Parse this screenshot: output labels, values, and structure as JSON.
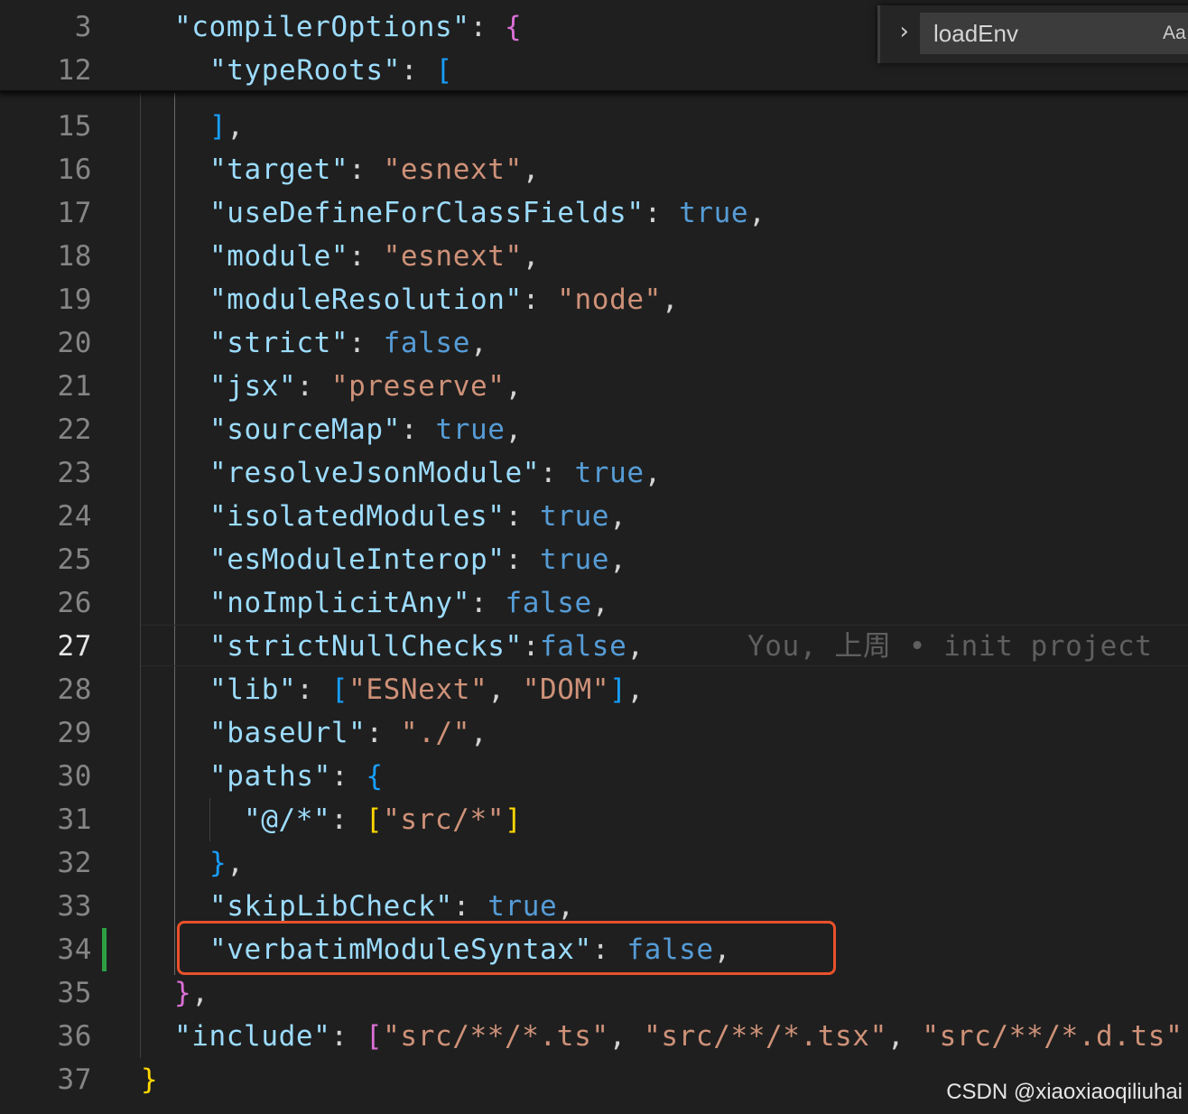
{
  "find": {
    "query": "loadEnv",
    "match_case_label": "Aa"
  },
  "sticky": [
    {
      "n": "3",
      "tokens": [
        [
          "k",
          "\"compilerOptions\""
        ],
        [
          "p",
          ": "
        ],
        [
          "br2",
          "{"
        ]
      ]
    },
    {
      "n": "12",
      "tokens": [
        [
          "k",
          "\"typeRoots\""
        ],
        [
          "p",
          ": "
        ],
        [
          "br3",
          "["
        ]
      ]
    }
  ],
  "lines": [
    {
      "n": "15",
      "tokens": [
        [
          "br3",
          "]"
        ],
        [
          "p",
          ","
        ]
      ]
    },
    {
      "n": "16",
      "tokens": [
        [
          "k",
          "\"target\""
        ],
        [
          "p",
          ": "
        ],
        [
          "s",
          "\"esnext\""
        ],
        [
          "p",
          ","
        ]
      ]
    },
    {
      "n": "17",
      "tokens": [
        [
          "k",
          "\"useDefineForClassFields\""
        ],
        [
          "p",
          ": "
        ],
        [
          "b",
          "true"
        ],
        [
          "p",
          ","
        ]
      ]
    },
    {
      "n": "18",
      "tokens": [
        [
          "k",
          "\"module\""
        ],
        [
          "p",
          ": "
        ],
        [
          "s",
          "\"esnext\""
        ],
        [
          "p",
          ","
        ]
      ]
    },
    {
      "n": "19",
      "tokens": [
        [
          "k",
          "\"moduleResolution\""
        ],
        [
          "p",
          ": "
        ],
        [
          "s",
          "\"node\""
        ],
        [
          "p",
          ","
        ]
      ]
    },
    {
      "n": "20",
      "tokens": [
        [
          "k",
          "\"strict\""
        ],
        [
          "p",
          ": "
        ],
        [
          "b",
          "false"
        ],
        [
          "p",
          ","
        ]
      ]
    },
    {
      "n": "21",
      "tokens": [
        [
          "k",
          "\"jsx\""
        ],
        [
          "p",
          ": "
        ],
        [
          "s",
          "\"preserve\""
        ],
        [
          "p",
          ","
        ]
      ]
    },
    {
      "n": "22",
      "tokens": [
        [
          "k",
          "\"sourceMap\""
        ],
        [
          "p",
          ": "
        ],
        [
          "b",
          "true"
        ],
        [
          "p",
          ","
        ]
      ]
    },
    {
      "n": "23",
      "tokens": [
        [
          "k",
          "\"resolveJsonModule\""
        ],
        [
          "p",
          ": "
        ],
        [
          "b",
          "true"
        ],
        [
          "p",
          ","
        ]
      ]
    },
    {
      "n": "24",
      "tokens": [
        [
          "k",
          "\"isolatedModules\""
        ],
        [
          "p",
          ": "
        ],
        [
          "b",
          "true"
        ],
        [
          "p",
          ","
        ]
      ]
    },
    {
      "n": "25",
      "tokens": [
        [
          "k",
          "\"esModuleInterop\""
        ],
        [
          "p",
          ": "
        ],
        [
          "b",
          "true"
        ],
        [
          "p",
          ","
        ]
      ]
    },
    {
      "n": "26",
      "tokens": [
        [
          "k",
          "\"noImplicitAny\""
        ],
        [
          "p",
          ": "
        ],
        [
          "b",
          "false"
        ],
        [
          "p",
          ","
        ]
      ]
    },
    {
      "n": "27",
      "tokens": [
        [
          "k",
          "\"strictNullChecks\""
        ],
        [
          "p",
          ":"
        ],
        [
          "b",
          "false"
        ],
        [
          "p",
          ","
        ]
      ],
      "blame": "You, 上周 • init project"
    },
    {
      "n": "28",
      "tokens": [
        [
          "k",
          "\"lib\""
        ],
        [
          "p",
          ": "
        ],
        [
          "br3",
          "["
        ],
        [
          "s",
          "\"ESNext\""
        ],
        [
          "p",
          ", "
        ],
        [
          "s",
          "\"DOM\""
        ],
        [
          "br3",
          "]"
        ],
        [
          "p",
          ","
        ]
      ]
    },
    {
      "n": "29",
      "tokens": [
        [
          "k",
          "\"baseUrl\""
        ],
        [
          "p",
          ": "
        ],
        [
          "s",
          "\"./\""
        ],
        [
          "p",
          ","
        ]
      ]
    },
    {
      "n": "30",
      "tokens": [
        [
          "k",
          "\"paths\""
        ],
        [
          "p",
          ": "
        ],
        [
          "br3",
          "{"
        ]
      ]
    },
    {
      "n": "31",
      "tokens": [
        [
          "k",
          "\"@/*\""
        ],
        [
          "p",
          ": "
        ],
        [
          "br1",
          "["
        ],
        [
          "s",
          "\"src/*\""
        ],
        [
          "br1",
          "]"
        ]
      ]
    },
    {
      "n": "32",
      "tokens": [
        [
          "br3",
          "}"
        ],
        [
          "p",
          ","
        ]
      ]
    },
    {
      "n": "33",
      "tokens": [
        [
          "k",
          "\"skipLibCheck\""
        ],
        [
          "p",
          ": "
        ],
        [
          "b",
          "true"
        ],
        [
          "p",
          ","
        ]
      ]
    },
    {
      "n": "34",
      "tokens": [
        [
          "k",
          "\"verbatimModuleSyntax\""
        ],
        [
          "p",
          ": "
        ],
        [
          "b",
          "false"
        ],
        [
          "p",
          ","
        ]
      ]
    },
    {
      "n": "35",
      "tokens": [
        [
          "br2",
          "}"
        ],
        [
          "p",
          ","
        ]
      ]
    },
    {
      "n": "36",
      "tokens": [
        [
          "k",
          "\"include\""
        ],
        [
          "p",
          ": "
        ],
        [
          "br2",
          "["
        ],
        [
          "s",
          "\"src/**/*.ts\""
        ],
        [
          "p",
          ", "
        ],
        [
          "s",
          "\"src/**/*.tsx\""
        ],
        [
          "p",
          ", "
        ],
        [
          "s",
          "\"src/**/*.d.ts\""
        ],
        [
          "p",
          ","
        ]
      ]
    },
    {
      "n": "37",
      "tokens": [
        [
          "br1",
          "}"
        ]
      ]
    }
  ],
  "watermark": "CSDN @xiaoxiaoqiliuhai"
}
